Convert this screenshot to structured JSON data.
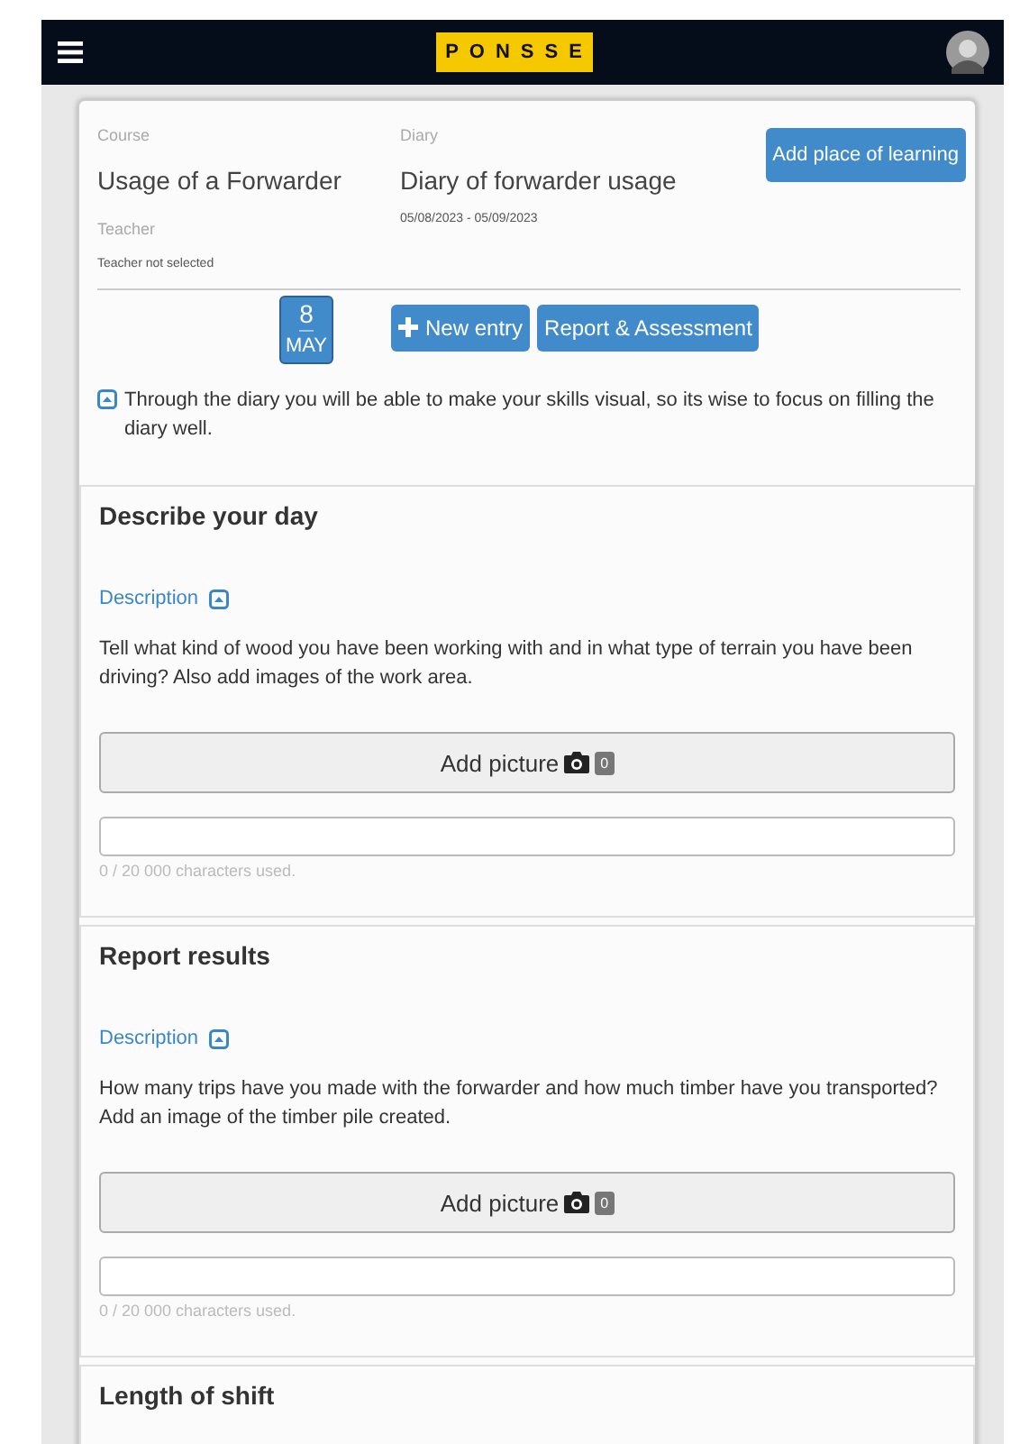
{
  "navbar": {
    "logo": "PONSSE"
  },
  "header": {
    "course_label": "Course",
    "course": "Usage of a Forwarder",
    "diary_label": "Diary",
    "diary": "Diary of forwarder usage",
    "teacher_label": "Teacher",
    "dates": "05/08/2023 - 05/09/2023",
    "teacher": "Teacher not selected",
    "add_place_button": "Add place of learning"
  },
  "date_badge": {
    "day": "8",
    "month": "MAY"
  },
  "actions": [
    "New entry",
    "Report & Assessment"
  ],
  "info": {
    "expanded": true,
    "text": "Through the diary you will be able to make your skills visual, so its wise to focus on filling the diary well."
  },
  "sections": [
    {
      "title": "Describe your day",
      "description_label": "Description",
      "expanded": true,
      "description": "Tell what kind of wood you have been working with and in what type of terrain you have been driving? Also add images of the work area.",
      "picture_button": "Add picture",
      "picture_count": "0",
      "char_count": "0 / 20 000 characters used."
    },
    {
      "title": "Report results",
      "description_label": "Description",
      "expanded": true,
      "description": "How many trips have you made with the forwarder and how much timber have you transported? Add an image of the timber pile created.",
      "picture_button": "Add picture",
      "picture_count": "0",
      "char_count": "0 / 20 000 characters used."
    },
    {
      "title": "Length of shift"
    }
  ]
}
